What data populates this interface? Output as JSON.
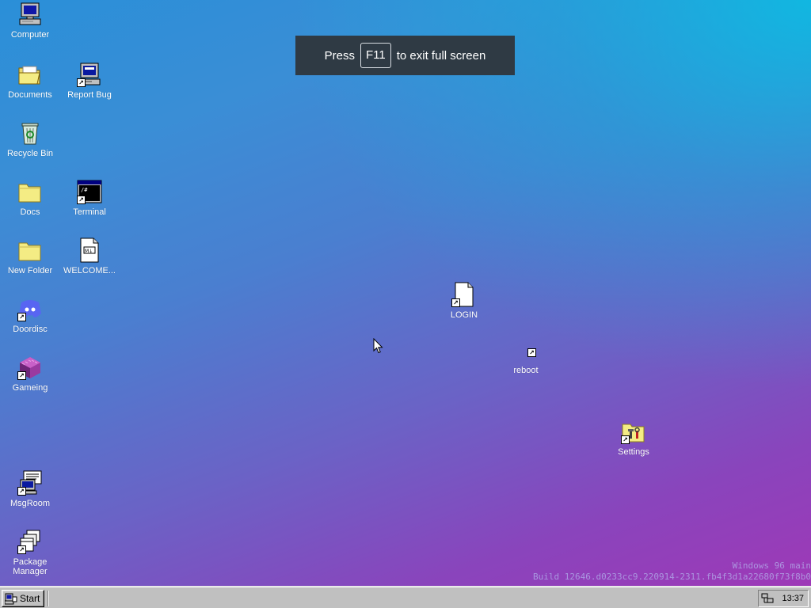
{
  "desktop_icons": {
    "computer": "Computer",
    "documents": "Documents",
    "report_bug": "Report Bug",
    "recycle_bin": "Recycle Bin",
    "docs": "Docs",
    "terminal": "Terminal",
    "new_folder": "New Folder",
    "welcome": "WELCOME...",
    "doordisc": "Doordisc",
    "gameing": "Gameing",
    "msgroom": "MsgRoom",
    "package_manager": "Package Manager",
    "login": "LOGIN",
    "reboot": "reboot",
    "settings": "Settings"
  },
  "fullscreen_toast": {
    "prefix": "Press",
    "key": "F11",
    "suffix": "to exit full screen"
  },
  "watermark": {
    "line1": "Windows 96 main",
    "line2": "Build 12646.d0233cc9.220914-2311.fb4f3d1a22680f73f8b0"
  },
  "taskbar": {
    "start_label": "Start",
    "clock": "13:37"
  },
  "colors": {
    "taskbar": "#c0c0c0",
    "toast_bg": "#2f3a44",
    "folder": "#f4ec84"
  }
}
